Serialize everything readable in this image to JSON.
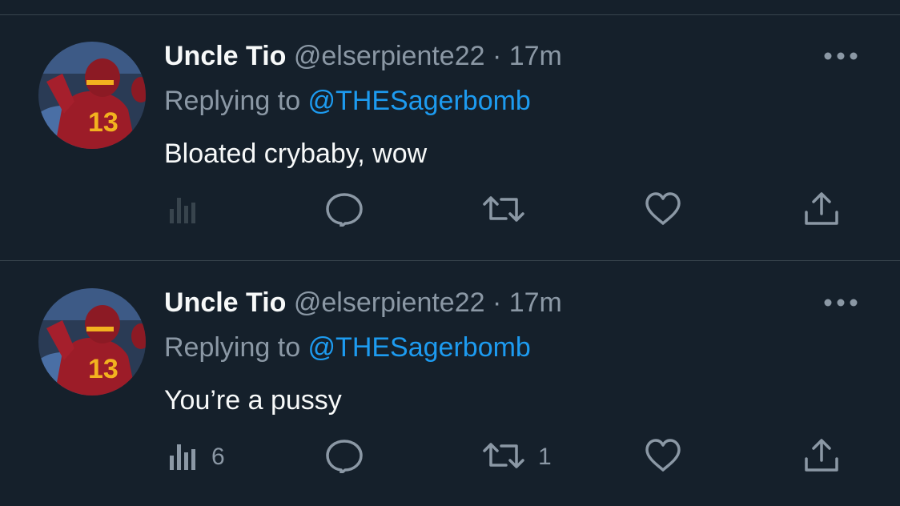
{
  "colors": {
    "background": "#15202b",
    "divider": "#38444d",
    "text_primary": "#f7f9f9",
    "text_secondary": "#8b98a5",
    "link": "#1d9bf0"
  },
  "tweets": [
    {
      "name": "Uncle Tio",
      "handle_time": "@elserpiente22 · 17m",
      "replying_prefix": "Replying to ",
      "replying_to": "@THESagerbomb",
      "text": "Bloated crybaby, wow",
      "analytics_count": "",
      "retweet_count": "",
      "icons": [
        "analytics-icon",
        "reply-icon",
        "retweet-icon",
        "like-icon",
        "share-icon",
        "more-icon"
      ]
    },
    {
      "name": "Uncle Tio",
      "handle_time": "@elserpiente22 · 17m",
      "replying_prefix": "Replying to ",
      "replying_to": "@THESagerbomb",
      "text": "You’re a pussy",
      "analytics_count": "6",
      "retweet_count": "1",
      "icons": [
        "analytics-icon",
        "reply-icon",
        "retweet-icon",
        "like-icon",
        "share-icon",
        "more-icon"
      ]
    }
  ]
}
